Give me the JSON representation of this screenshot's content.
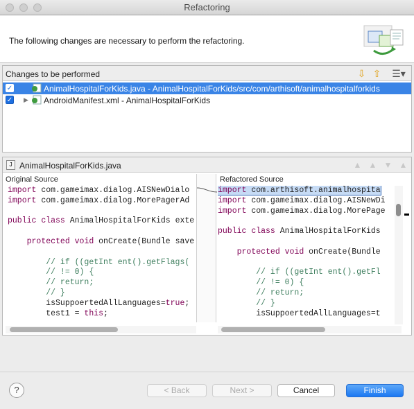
{
  "window": {
    "title": "Refactoring"
  },
  "header": {
    "message": "The following changes are necessary to perform the refactoring."
  },
  "changes": {
    "heading": "Changes to be performed",
    "items": [
      {
        "label": "AnimalHospitalForKids.java - AnimalHospitalForKids/src/com/arthisoft/animalhospitalforkids",
        "checked": true,
        "selected": true
      },
      {
        "label": "AndroidManifest.xml - AnimalHospitalForKids",
        "checked": true,
        "selected": false
      }
    ]
  },
  "compare": {
    "file": "AnimalHospitalForKids.java",
    "original_label": "Original Source",
    "refactored_label": "Refactored Source",
    "original_lines": [
      "import com.gameimax.dialog.AISNewDialo",
      "import com.gameimax.dialog.MorePagerAd",
      "",
      "public class AnimalHospitalForKids exte",
      "",
      "    protected void onCreate(Bundle save",
      "",
      "        // if ((getInt ent().getFlags(",
      "        // != 0) {",
      "        // return;",
      "        // }",
      "        isSuppoertedAllLanguages=true;",
      "        test1 = this;"
    ],
    "refactored_lines": [
      "import com.arthisoft.animalhospita",
      "import com.gameimax.dialog.AISNewDi",
      "import com.gameimax.dialog.MorePage",
      "",
      "public class AnimalHospitalForKids",
      "",
      "    protected void onCreate(Bundle",
      "",
      "        // if ((getInt ent().getFl",
      "        // != 0) {",
      "        // return;",
      "        // }",
      "        isSuppoertedAllLanguages=t"
    ]
  },
  "buttons": {
    "help": "?",
    "back": "< Back",
    "next": "Next >",
    "cancel": "Cancel",
    "finish": "Finish"
  }
}
